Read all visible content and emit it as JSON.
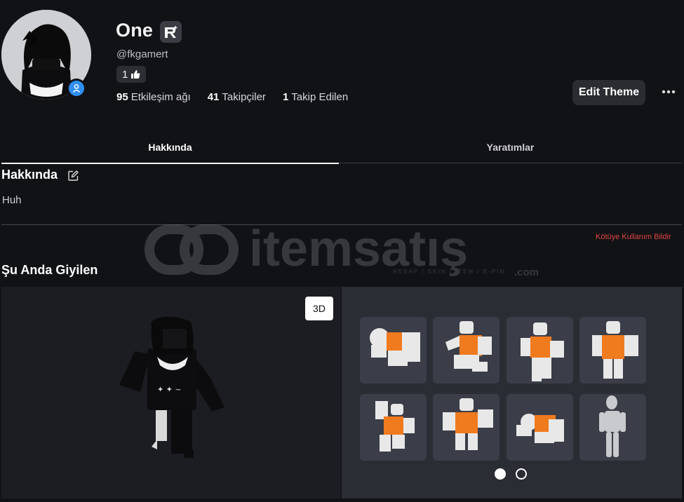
{
  "profile": {
    "display_name": "One",
    "username": "@fkgamert",
    "like_count": "1",
    "stats": [
      {
        "value": "95",
        "label": "Etkileşim ağı"
      },
      {
        "value": "41",
        "label": "Takipçiler"
      },
      {
        "value": "1",
        "label": "Takip Edilen"
      }
    ],
    "edit_theme_label": "Edit Theme"
  },
  "tabs": [
    {
      "label": "Hakkında",
      "active": true
    },
    {
      "label": "Yaratımlar",
      "active": false
    }
  ],
  "about": {
    "title": "Hakkında",
    "text": "Huh",
    "report_label": "Kötüye Kullanım Bildir"
  },
  "wearing": {
    "title": "Şu Anda Giyilen",
    "view_toggle_label": "3D",
    "emote_count": 8,
    "page_dots": 2,
    "active_page": 1
  },
  "watermark": {
    "brand": "itemsatış",
    "tagline": "HESAP / SKIN / ITEM / E-PIN",
    "suffix": ".com"
  },
  "colors": {
    "background": "#111216",
    "accent_blue": "#2f8ff7",
    "report_red": "#e0463f",
    "character_shirt": "#f07a1e"
  },
  "icons": [
    "premium-icon",
    "thumbs-up-icon",
    "user-status-icon",
    "more-options-icon",
    "edit-icon"
  ]
}
